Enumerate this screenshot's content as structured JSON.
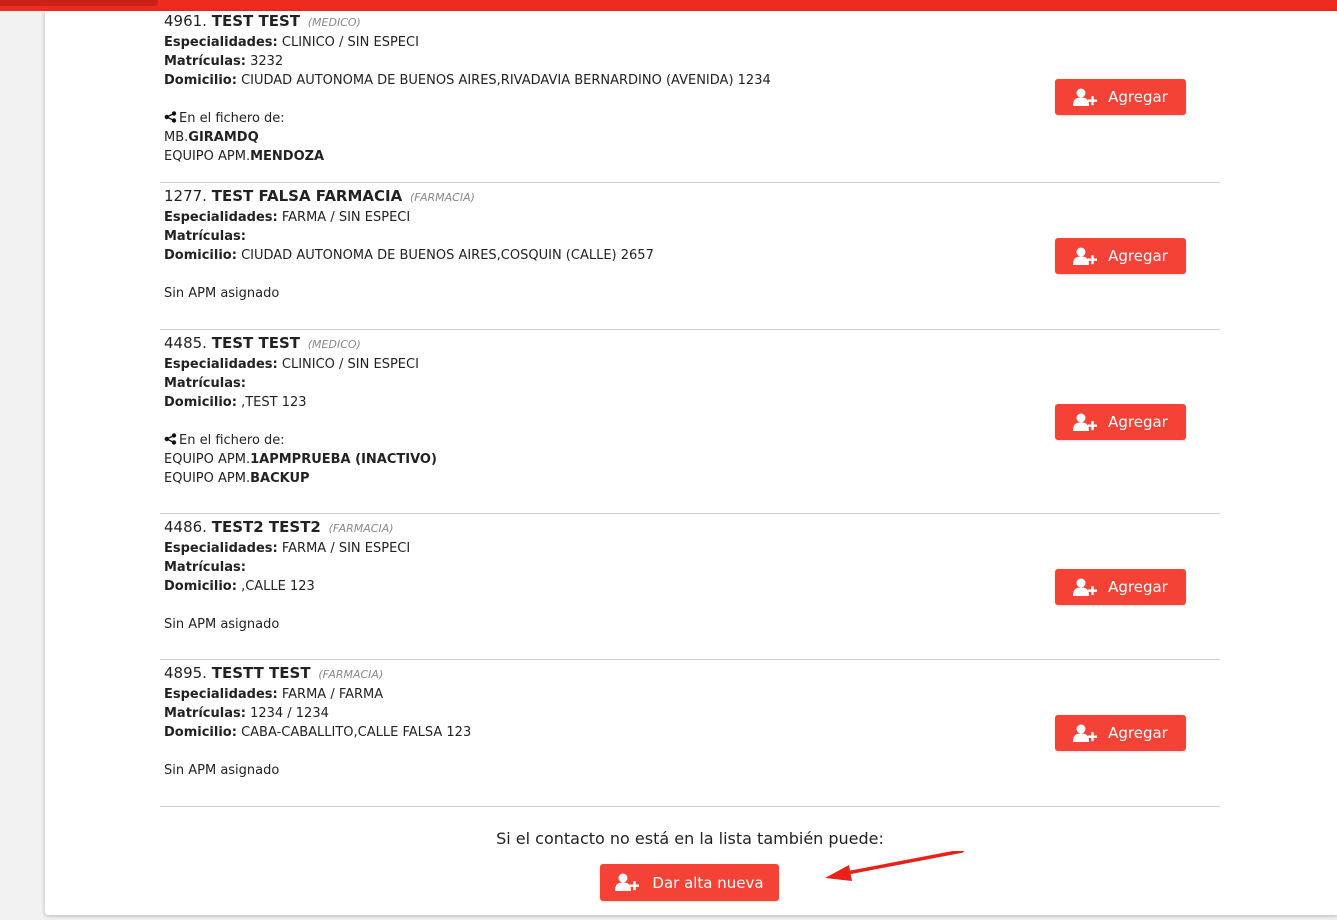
{
  "theme": {
    "accent": "#f44336",
    "header": "#ef2b1f"
  },
  "contacts": [
    {
      "id": "4961.",
      "name": "TEST TEST",
      "type": "(MEDICO)",
      "especialidades_label": "Especialidades:",
      "especialidades": "CLINICO / SIN ESPECI",
      "matriculas_label": "Matrículas:",
      "matriculas": "3232",
      "domicilio_label": "Domicilio:",
      "domicilio": "CIUDAD AUTONOMA DE BUENOS AIRES,RIVADAVIA BERNARDINO (AVENIDA) 1234",
      "fichero_label": "En el fichero de:",
      "ficheros": [
        {
          "prefix": "MB.",
          "name": "GIRAMDQ"
        },
        {
          "prefix": "EQUIPO APM.",
          "name": "MENDOZA"
        }
      ],
      "button": "Agregar"
    },
    {
      "id": "1277.",
      "name": "TEST FALSA FARMACIA",
      "type": "(FARMACIA)",
      "especialidades_label": "Especialidades:",
      "especialidades": "FARMA / SIN ESPECI",
      "matriculas_label": "Matrículas:",
      "matriculas": "",
      "domicilio_label": "Domicilio:",
      "domicilio": "CIUDAD AUTONOMA DE BUENOS AIRES,COSQUIN (CALLE) 2657",
      "sin_apm": "Sin APM asignado",
      "button": "Agregar"
    },
    {
      "id": "4485.",
      "name": "TEST TEST",
      "type": "(MEDICO)",
      "especialidades_label": "Especialidades:",
      "especialidades": "CLINICO / SIN ESPECI",
      "matriculas_label": "Matrículas:",
      "matriculas": "",
      "domicilio_label": "Domicilio:",
      "domicilio": ",TEST 123",
      "fichero_label": "En el fichero de:",
      "ficheros": [
        {
          "prefix": "EQUIPO APM.",
          "name": "1APMPRUEBA (INACTIVO)"
        },
        {
          "prefix": "EQUIPO APM.",
          "name": "BACKUP"
        }
      ],
      "button": "Agregar"
    },
    {
      "id": "4486.",
      "name": "TEST2 TEST2",
      "type": "(FARMACIA)",
      "especialidades_label": "Especialidades:",
      "especialidades": "FARMA / SIN ESPECI",
      "matriculas_label": "Matrículas:",
      "matriculas": "",
      "domicilio_label": "Domicilio:",
      "domicilio": ",CALLE 123",
      "sin_apm": "Sin APM asignado",
      "button": "Agregar"
    },
    {
      "id": "4895.",
      "name": "TESTT TEST",
      "type": "(FARMACIA)",
      "especialidades_label": "Especialidades:",
      "especialidades": "FARMA / FARMA",
      "matriculas_label": "Matrículas:",
      "matriculas": "1234 / 1234",
      "domicilio_label": "Domicilio:",
      "domicilio": "CABA-CABALLITO,CALLE FALSA 123",
      "sin_apm": "Sin APM asignado",
      "button": "Agregar"
    }
  ],
  "footer": {
    "text": "Si el contacto no está en la lista también puede:",
    "new_button": "Dar alta nueva"
  },
  "icons": {
    "add_user": "add-user-icon",
    "share": "share-icon",
    "arrow": "arrow-annotation"
  }
}
